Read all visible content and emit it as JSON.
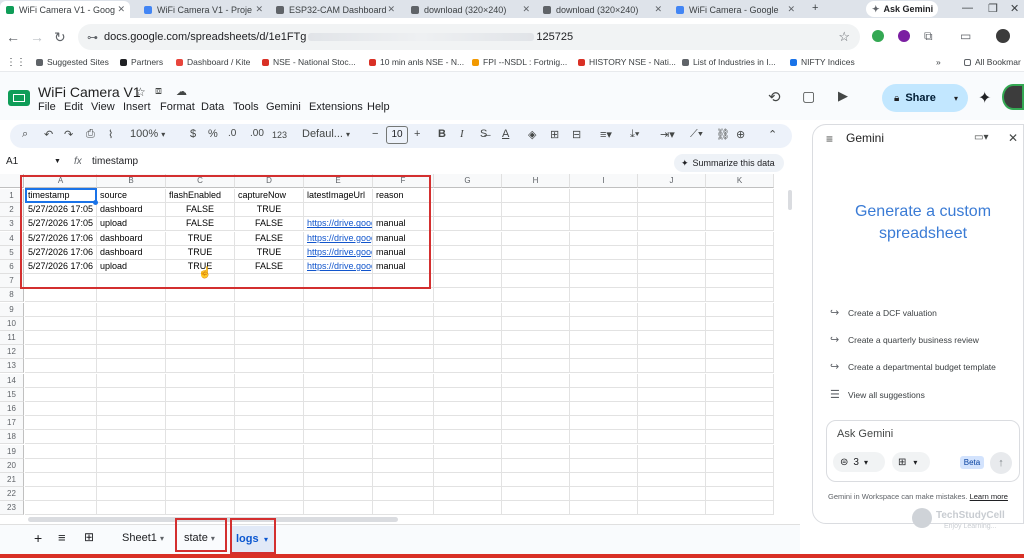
{
  "browser": {
    "tabs": [
      {
        "label": "WiFi Camera V1 - Goog",
        "color": "#0f9d58"
      },
      {
        "label": "WiFi Camera V1 - Proje",
        "color": "#4285f4"
      },
      {
        "label": "ESP32-CAM Dashboard",
        "color": "#5f6368"
      },
      {
        "label": "download (320×240)",
        "color": "#5f6368"
      },
      {
        "label": "download (320×240)",
        "color": "#5f6368"
      },
      {
        "label": "WiFi Camera - Google",
        "color": "#4285f4"
      }
    ],
    "new_tab_label": "+",
    "ask_gemini_label": "Ask Gemini",
    "url": "docs.google.com/spreadsheets/d/1e1FTg",
    "url_tail": "125725",
    "bookmarks": [
      "Suggested Sites",
      "Partners",
      "Dashboard / Kite",
      "NSE - National Stoc...",
      "10 min anls NSE - N...",
      "FPI --NSDL : Fortnig...",
      "HISTORY NSE - Nati...",
      "List of Industries in I...",
      "NIFTY Indices"
    ],
    "all_bookmarks_label": "All Bookmar"
  },
  "sheets": {
    "doc_title": "WiFi Camera V1",
    "menus": [
      "File",
      "Edit",
      "View",
      "Insert",
      "Format",
      "Data",
      "Tools",
      "Gemini",
      "Extensions",
      "Help"
    ],
    "share_label": "Share",
    "toolbar": {
      "zoom": "100%",
      "currency": "$",
      "percent": "%",
      "decrease_decimal": ".0",
      "increase_decimal": ".00",
      "number_format": "123",
      "font": "Defaul...",
      "font_size": "10",
      "minus": "−",
      "plus": "+",
      "bold": "B",
      "italic": "I"
    },
    "name_box": "A1",
    "fx": "fx",
    "formula": "timestamp",
    "summarize_label": "Summarize this data",
    "columns": [
      "A",
      "B",
      "C",
      "D",
      "E",
      "F",
      "G",
      "H",
      "I",
      "J",
      "K"
    ],
    "rows": [
      "1",
      "2",
      "3",
      "4",
      "5",
      "6",
      "7",
      "8",
      "9",
      "10",
      "11",
      "12",
      "13",
      "14",
      "15",
      "16",
      "17",
      "18",
      "19",
      "20",
      "21",
      "22",
      "23"
    ],
    "cells": [
      [
        "timestamp",
        "source",
        "flashEnabled",
        "captureNow",
        "latestImageUrl",
        "reason"
      ],
      [
        "5/27/2026 17:05",
        "dashboard",
        "FALSE",
        "TRUE",
        "",
        ""
      ],
      [
        "5/27/2026 17:05",
        "upload",
        "FALSE",
        "FALSE",
        "https://drive.goog",
        "manual"
      ],
      [
        "5/27/2026 17:06",
        "dashboard",
        "TRUE",
        "FALSE",
        "https://drive.goog",
        "manual"
      ],
      [
        "5/27/2026 17:06",
        "dashboard",
        "TRUE",
        "TRUE",
        "https://drive.goog",
        "manual"
      ],
      [
        "5/27/2026 17:06",
        "upload",
        "TRUE",
        "FALSE",
        "https://drive.goog",
        "manual"
      ]
    ],
    "sheet_tabs": [
      "Sheet1",
      "state",
      "logs"
    ],
    "add_sheet": "+",
    "accent": "#0b57d0",
    "highlight_color": "#d32f2f"
  },
  "gemini": {
    "title": "Gemini",
    "heading_line1": "Generate a custom",
    "heading_line2": "spreadsheet",
    "suggestions": [
      "Create a DCF valuation",
      "Create a quarterly business review",
      "Create a departmental budget template",
      "View all suggestions"
    ],
    "ask_placeholder": "Ask Gemini",
    "count": "3",
    "beta": "Beta",
    "disclaimer": "Gemini in Workspace can make mistakes.",
    "learn_more": "Learn more"
  },
  "watermark": {
    "line1": "TechStudyCell",
    "line2": "Enjoy Learning..."
  }
}
